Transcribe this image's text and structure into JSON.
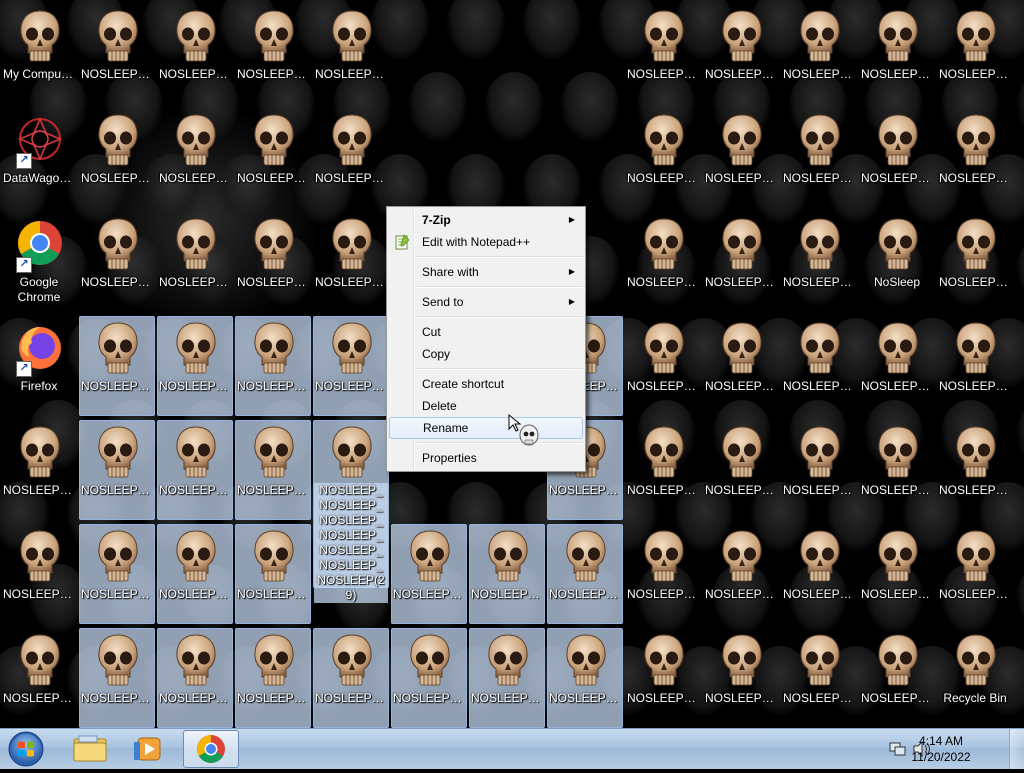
{
  "desktop": {
    "sys_icons": [
      {
        "name": "my-computer",
        "label": "My Computer"
      },
      {
        "name": "datawagon",
        "label": "DataWagon..."
      },
      {
        "name": "google-chrome",
        "label": "Google Chrome"
      },
      {
        "name": "firefox",
        "label": "Firefox"
      }
    ],
    "file_label": "NOSLEEP_N...",
    "nosleep_label": "NoSleep",
    "recycle_label": "Recycle Bin",
    "rename_text": "NOSLEEP_NOSLEEP_NOSLEEP_NOSLEEP_NOSLEEP_NOSLEEP_NOSLEEP(29)"
  },
  "context_menu": {
    "items": [
      {
        "label": "7-Zip",
        "bold": true,
        "submenu": true
      },
      {
        "label": "Edit with Notepad++",
        "icon": "notepad-plus-icon"
      },
      {
        "sep": true
      },
      {
        "label": "Share with",
        "submenu": true
      },
      {
        "sep": true
      },
      {
        "label": "Send to",
        "submenu": true
      },
      {
        "sep": true
      },
      {
        "label": "Cut"
      },
      {
        "label": "Copy"
      },
      {
        "sep": true
      },
      {
        "label": "Create shortcut"
      },
      {
        "label": "Delete"
      },
      {
        "label": "Rename",
        "hover": true
      },
      {
        "sep": true
      },
      {
        "label": "Properties"
      }
    ]
  },
  "taskbar": {
    "buttons": [
      {
        "name": "start-orb",
        "icon": "windows-logo-icon"
      },
      {
        "name": "explorer",
        "icon": "folder-icon"
      },
      {
        "name": "media-player",
        "icon": "media-player-icon"
      },
      {
        "name": "chrome",
        "icon": "chrome-icon",
        "active": true
      }
    ],
    "clock": {
      "time": "4:14 AM",
      "date": "11/20/2022"
    }
  }
}
